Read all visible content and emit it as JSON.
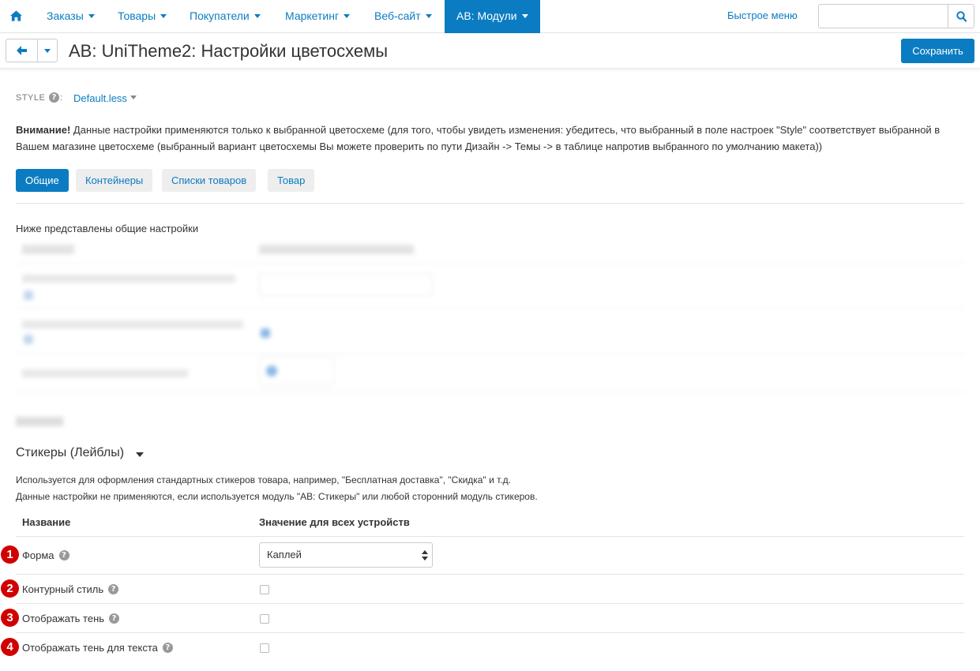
{
  "nav": {
    "items": [
      {
        "label": "Заказы"
      },
      {
        "label": "Товары"
      },
      {
        "label": "Покупатели"
      },
      {
        "label": "Маркетинг"
      },
      {
        "label": "Веб-сайт"
      },
      {
        "label": "AB: Модули"
      }
    ],
    "quick_menu": "Быстрое меню",
    "search_placeholder": ""
  },
  "header": {
    "title": "AB: UniTheme2: Настройки цветосхемы",
    "save_label": "Сохранить"
  },
  "style": {
    "label": "STYLE",
    "colon": ":",
    "value": "Default.less"
  },
  "warning": {
    "bold": "Внимание!",
    "text": " Данные настройки применяются только к выбранной цветосхеме (для того, чтобы увидеть изменения: убедитесь, что выбранный в поле настроек \"Style\" соответствует выбранной в Вашем магазине цветосхеме (выбранный вариант цветосхемы Вы можете проверить по пути Дизайн -> Темы -> в таблице напротив выбранного по умолчанию макета))"
  },
  "tabs": [
    {
      "label": "Общие"
    },
    {
      "label": "Контейнеры"
    },
    {
      "label": "Списки товаров"
    },
    {
      "label": "Товар"
    }
  ],
  "general": {
    "description": "Ниже представлены общие настройки"
  },
  "stickers": {
    "title": "Стикеры (Лейблы)",
    "desc_line1": "Используется для оформления стандартных стикеров товара, например, \"Бесплатная доставка\", \"Скидка\" и т.д.",
    "desc_line2": "Данные настройки не применяются, если используется модуль \"AB: Стикеры\" или любой сторонний модуль стикеров.",
    "col_name": "Название",
    "col_value": "Значение для всех устройств",
    "rows": [
      {
        "marker": "1",
        "label": "Форма",
        "value": "Каплей"
      },
      {
        "marker": "2",
        "label": "Контурный стиль"
      },
      {
        "marker": "3",
        "label": "Отображать тень"
      },
      {
        "marker": "4",
        "label": "Отображать тень для текста"
      }
    ]
  },
  "colors": {
    "accent": "#0b7cc1",
    "marker": "#d00000"
  }
}
